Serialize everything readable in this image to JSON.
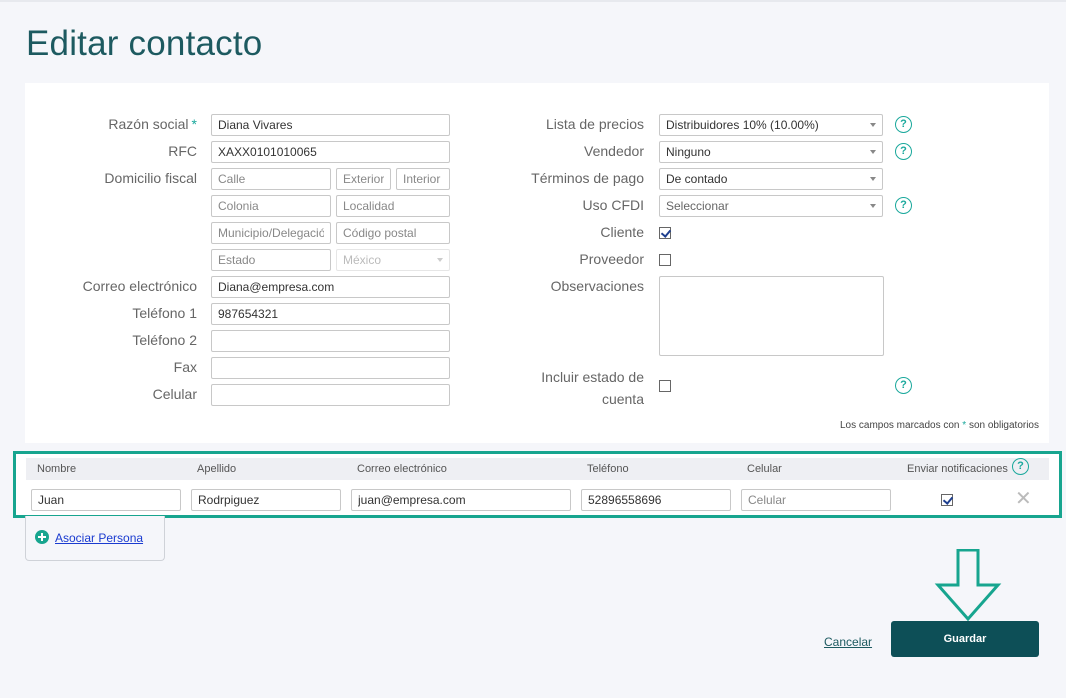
{
  "page": {
    "title": "Editar contacto"
  },
  "left": {
    "razon_social_label": "Razón social",
    "razon_social_value": "Diana Vivares",
    "rfc_label": "RFC",
    "rfc_value": "XAXX0101010065",
    "domicilio_label": "Domicilio fiscal",
    "calle_ph": "Calle",
    "exterior_ph": "Exterior",
    "interior_ph": "Interior",
    "colonia_ph": "Colonia",
    "localidad_ph": "Localidad",
    "municipio_ph": "Municipio/Delegación",
    "cp_ph": "Código postal",
    "estado_ph": "Estado",
    "pais_value": "México",
    "correo_label": "Correo electrónico",
    "correo_value": "Diana@empresa.com",
    "tel1_label": "Teléfono 1",
    "tel1_value": "987654321",
    "tel2_label": "Teléfono 2",
    "fax_label": "Fax",
    "celular_label": "Celular"
  },
  "right": {
    "lista_label": "Lista de precios",
    "lista_value": "Distribuidores 10% (10.00%)",
    "vendedor_label": "Vendedor",
    "vendedor_value": "Ninguno",
    "terminos_label": "Términos de pago",
    "terminos_value": "De contado",
    "uso_label": "Uso CFDI",
    "uso_value": "Seleccionar",
    "cliente_label": "Cliente",
    "cliente_checked": true,
    "proveedor_label": "Proveedor",
    "proveedor_checked": false,
    "observaciones_label": "Observaciones",
    "estado_cuenta_label_1": "Incluir estado de",
    "estado_cuenta_label_2": "cuenta",
    "estado_cuenta_checked": false,
    "help_glyph": "?"
  },
  "required_note": {
    "before": "Los campos marcados con ",
    "star": "*",
    "after": " son obligatorios"
  },
  "required_star": "*",
  "persons": {
    "headers": [
      "Nombre",
      "Apellido",
      "Correo electrónico",
      "Teléfono",
      "Celular",
      "Enviar notificaciones"
    ],
    "row": {
      "nombre": "Juan",
      "apellido": "Rodrpiguez",
      "correo": "juan@empresa.com",
      "telefono": "52896558696",
      "celular_ph": "Celular",
      "notificar": true
    },
    "delete_glyph": "✕"
  },
  "associate": {
    "label": "Asociar Persona"
  },
  "actions": {
    "cancel": "Cancelar",
    "save": "Guardar"
  },
  "colors": {
    "accent": "#17a58f",
    "primary": "#0d4f57",
    "title": "#1d5a60"
  }
}
